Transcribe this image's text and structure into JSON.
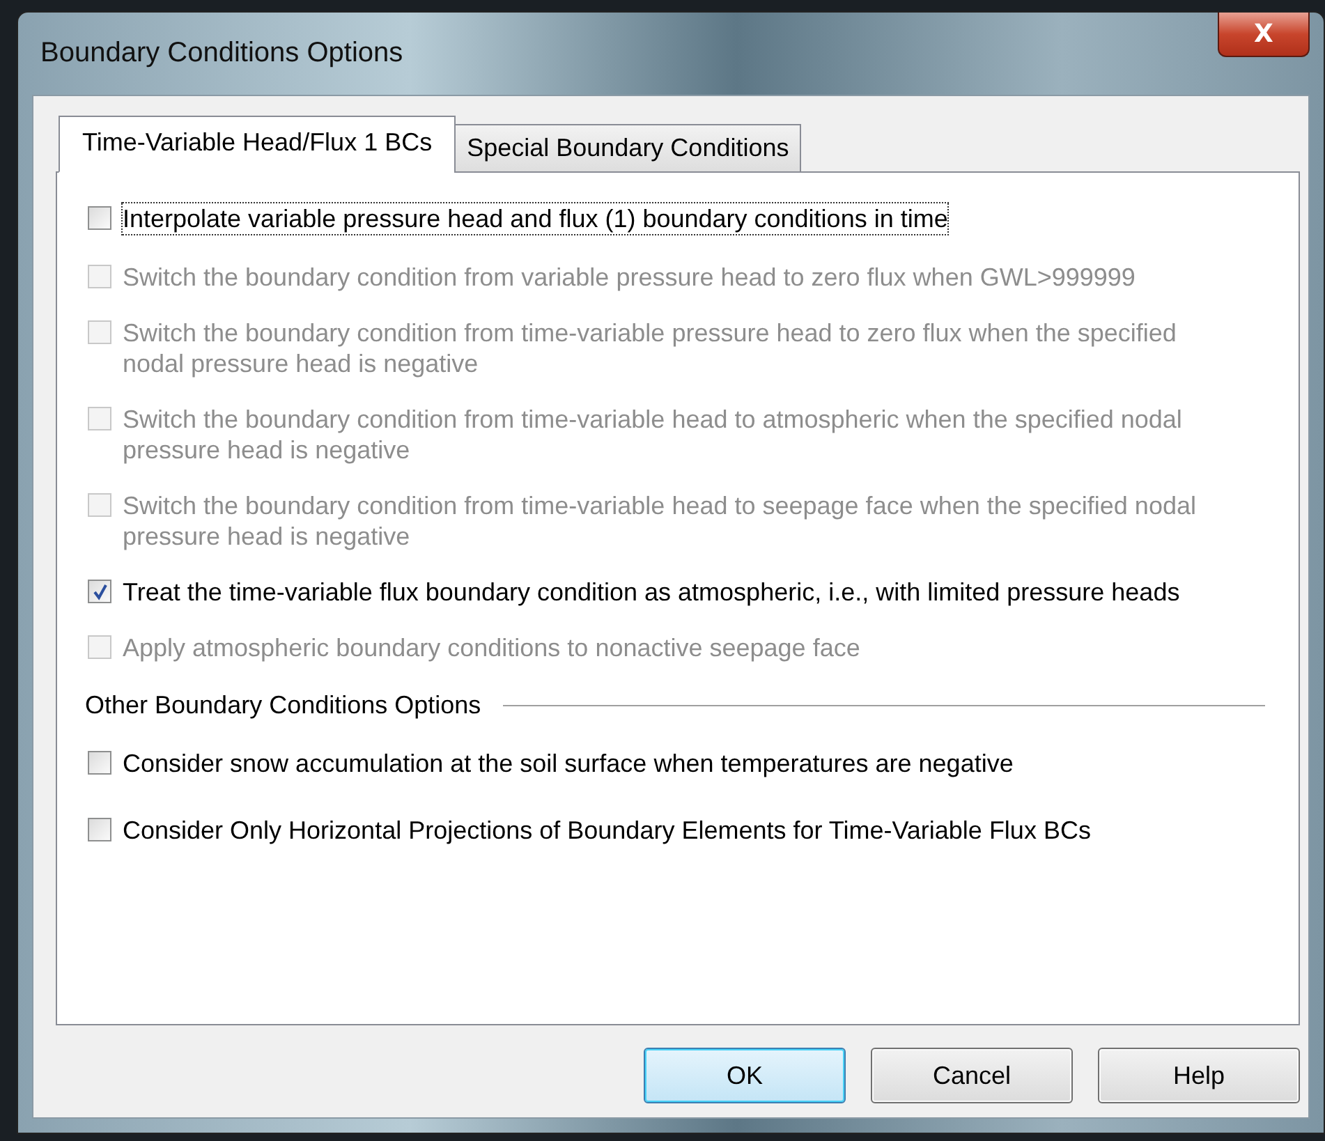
{
  "window": {
    "title": "Boundary Conditions Options",
    "close": "X"
  },
  "tabs": [
    {
      "label": "Time-Variable Head/Flux 1 BCs",
      "selected": true
    },
    {
      "label": "Special Boundary Conditions",
      "selected": false
    }
  ],
  "options": [
    {
      "label": "Interpolate variable pressure head and flux (1) boundary conditions in time",
      "checked": false,
      "disabled": false,
      "focused": true
    },
    {
      "label": "Switch the boundary condition from variable pressure head to zero flux when GWL>999999",
      "checked": false,
      "disabled": true,
      "focused": false
    },
    {
      "label": "Switch the boundary condition from time-variable pressure head to zero flux when the specified nodal pressure head is negative",
      "checked": false,
      "disabled": true,
      "focused": false
    },
    {
      "label": "Switch the boundary condition from time-variable head to atmospheric when the specified nodal pressure head is negative",
      "checked": false,
      "disabled": true,
      "focused": false
    },
    {
      "label": "Switch the boundary condition from time-variable head to seepage face when the specified nodal pressure head is negative",
      "checked": false,
      "disabled": true,
      "focused": false
    },
    {
      "label": "Treat the time-variable flux boundary condition as atmospheric, i.e., with limited pressure heads",
      "checked": true,
      "disabled": false,
      "focused": false
    },
    {
      "label": "Apply atmospheric boundary conditions to nonactive seepage face",
      "checked": false,
      "disabled": true,
      "focused": false
    }
  ],
  "other_section": {
    "title": "Other Boundary Conditions Options",
    "options": [
      {
        "label": "Consider snow accumulation at the soil surface when temperatures are negative",
        "checked": false,
        "disabled": false,
        "focused": false
      },
      {
        "label": "Consider Only Horizontal Projections of Boundary Elements for Time-Variable Flux BCs",
        "checked": false,
        "disabled": false,
        "focused": false
      }
    ]
  },
  "buttons": [
    {
      "label": "OK",
      "default": true
    },
    {
      "label": "Cancel",
      "default": false
    },
    {
      "label": "Help",
      "default": false
    }
  ]
}
